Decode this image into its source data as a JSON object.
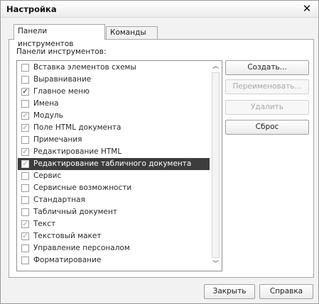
{
  "window": {
    "title": "Настройка",
    "close_glyph": "✕"
  },
  "tabs": [
    {
      "label": "Панели инструментов",
      "active": true
    },
    {
      "label": "Команды",
      "active": false
    }
  ],
  "list_label": "Панели инструментов:",
  "toolbars": [
    {
      "label": "Вставка элементов схемы",
      "state": "unchecked"
    },
    {
      "label": "Выравнивание",
      "state": "unchecked"
    },
    {
      "label": "Главное меню",
      "state": "checked"
    },
    {
      "label": "Имена",
      "state": "unchecked"
    },
    {
      "label": "Модуль",
      "state": "checked-gray"
    },
    {
      "label": "Поле HTML документа",
      "state": "checked-gray"
    },
    {
      "label": "Примечания",
      "state": "unchecked"
    },
    {
      "label": "Редактирование HTML",
      "state": "checked-gray"
    },
    {
      "label": "Редактирование табличного документа",
      "state": "checked-gray",
      "selected": true
    },
    {
      "label": "Сервис",
      "state": "unchecked"
    },
    {
      "label": "Сервисные возможности",
      "state": "unchecked"
    },
    {
      "label": "Стандартная",
      "state": "unchecked"
    },
    {
      "label": "Табличный документ",
      "state": "unchecked"
    },
    {
      "label": "Текст",
      "state": "checked-gray"
    },
    {
      "label": "Текстовый макет",
      "state": "checked-gray"
    },
    {
      "label": "Управление персоналом",
      "state": "unchecked"
    },
    {
      "label": "Форматирование",
      "state": "unchecked"
    }
  ],
  "scrollbar": {
    "up_glyph": "︿",
    "down_glyph": "﹀"
  },
  "side_buttons": {
    "create": "Создать...",
    "rename": "Переименовать...",
    "delete": "Удалить",
    "reset": "Сброс"
  },
  "footer_buttons": {
    "close": "Закрыть",
    "help": "Справка"
  }
}
